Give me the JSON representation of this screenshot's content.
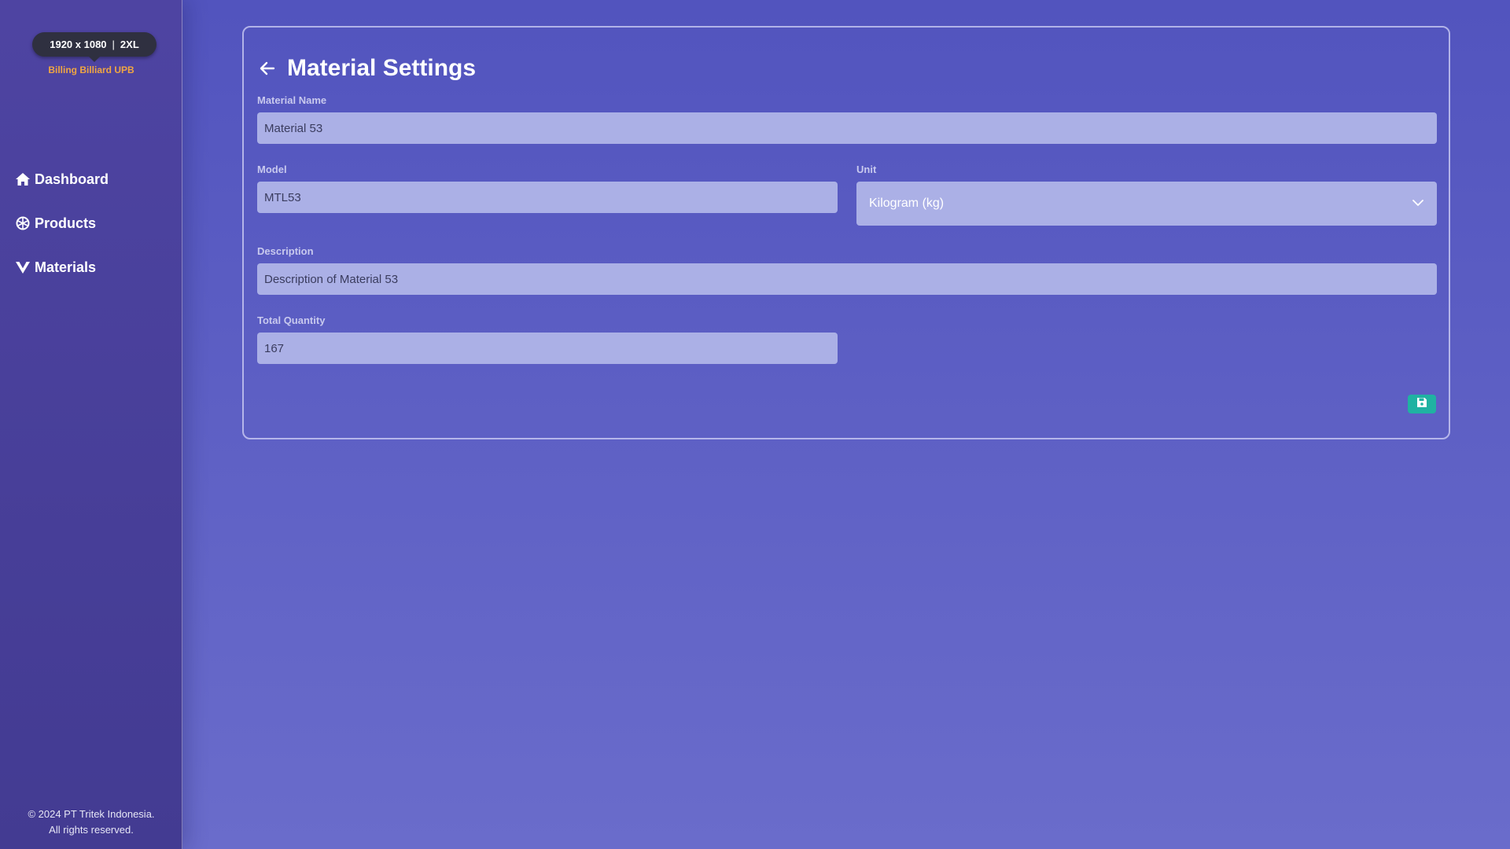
{
  "device_badge": {
    "resolution": "1920 x 1080",
    "breakpoint": "2XL"
  },
  "brand": {
    "name": "Billing Billiard UPB",
    "color": "#f0a642"
  },
  "sidebar": {
    "items": [
      {
        "label": "Dashboard",
        "icon": "home-icon"
      },
      {
        "label": "Products",
        "icon": "box-icon"
      },
      {
        "label": "Materials",
        "icon": "material-icon"
      }
    ],
    "footer_line1": "© 2024 PT Tritek Indonesia.",
    "footer_line2": "All rights reserved."
  },
  "page": {
    "title": "Material Settings",
    "back_icon": "arrow-left-icon"
  },
  "form": {
    "material_name": {
      "label": "Material Name",
      "value": "Material 53"
    },
    "model": {
      "label": "Model",
      "value": "MTL53"
    },
    "unit": {
      "label": "Unit",
      "value": "Kilogram (kg)"
    },
    "description": {
      "label": "Description",
      "value": "Description of Material 53"
    },
    "total_quantity": {
      "label": "Total Quantity",
      "value": "167"
    },
    "save_icon": "save-icon"
  },
  "colors": {
    "accent_save": "#20b2a2",
    "input_bg": "#abb0e6",
    "sidebar_bg": "#4e44a2",
    "main_bg": "#5a5cc4"
  }
}
